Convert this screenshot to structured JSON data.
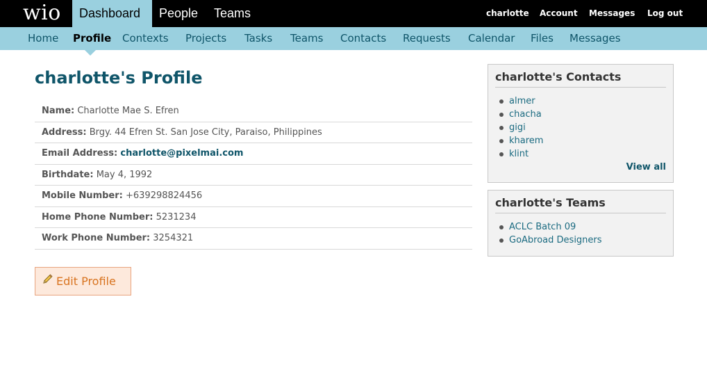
{
  "brand": {
    "logo": "wio"
  },
  "main_nav": [
    {
      "label": "Dashboard",
      "active": true
    },
    {
      "label": "People",
      "active": false
    },
    {
      "label": "Teams",
      "active": false
    }
  ],
  "user_nav": {
    "username": "charlotte",
    "account": "Account",
    "messages": "Messages",
    "logout": "Log out"
  },
  "sub_nav": [
    {
      "label": "Home"
    },
    {
      "label": "Profile",
      "active": true
    },
    {
      "label": "Contexts"
    },
    {
      "label": "Projects"
    },
    {
      "label": "Tasks"
    },
    {
      "label": "Teams"
    },
    {
      "label": "Contacts"
    },
    {
      "label": "Requests"
    },
    {
      "label": "Calendar"
    },
    {
      "label": "Files"
    },
    {
      "label": "Messages"
    }
  ],
  "profile": {
    "title": "charlotte's Profile",
    "fields": [
      {
        "label": "Name:",
        "value": "Charlotte Mae S. Efren"
      },
      {
        "label": "Address:",
        "value": "Brgy. 44 Efren St. San Jose City, Paraiso, Philippines"
      },
      {
        "label": "Email Address:",
        "value": "charlotte@pixelmai.com"
      },
      {
        "label": "Birthdate:",
        "value": "May 4, 1992"
      },
      {
        "label": "Mobile Number:",
        "value": "+639298824456"
      },
      {
        "label": "Home Phone Number:",
        "value": "5231234"
      },
      {
        "label": "Work Phone Number:",
        "value": "3254321"
      }
    ],
    "edit_label": "Edit Profile"
  },
  "contacts": {
    "title": "charlotte's Contacts",
    "items": [
      "almer",
      "chacha",
      "gigi",
      "kharem",
      "klint"
    ],
    "view_all": "View all"
  },
  "teams": {
    "title": "charlotte's Teams",
    "items": [
      "ACLC Batch 09",
      "GoAbroad Designers"
    ]
  },
  "colors": {
    "topbar": "#000000",
    "subnav": "#9ad0df",
    "accent": "#0f5569",
    "edit_button_bg": "#fde9dc",
    "edit_button_text": "#d8731f"
  }
}
